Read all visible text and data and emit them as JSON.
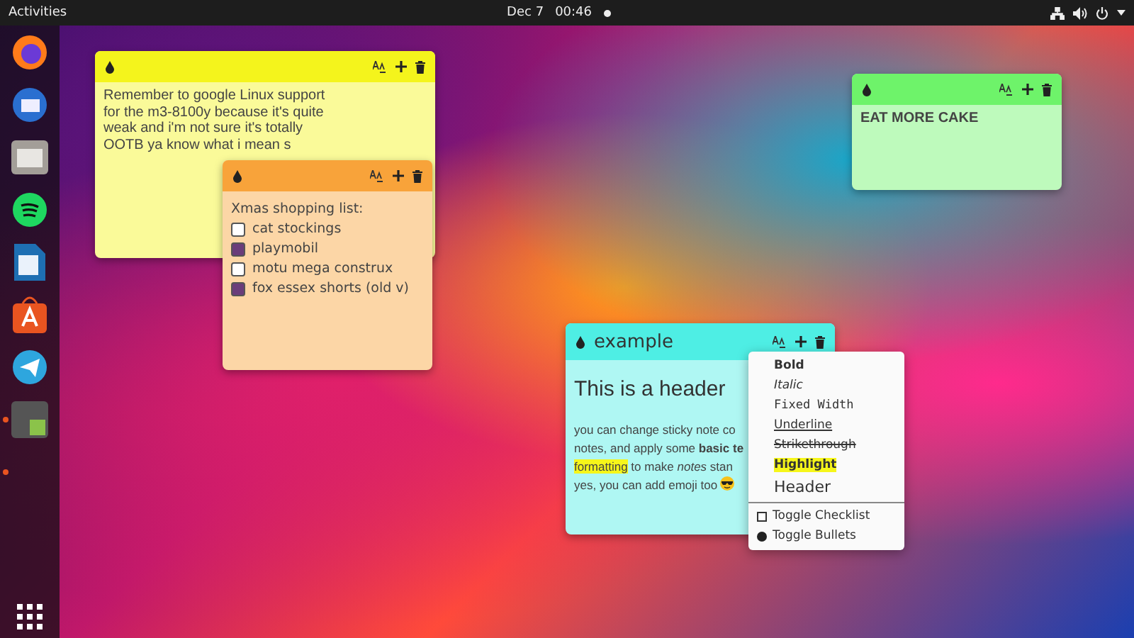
{
  "top_bar": {
    "activities": "Activities",
    "date": "Dec 7",
    "time": "00:46"
  },
  "dock": {
    "apps": [
      {
        "kind": "browser",
        "running": false
      },
      {
        "kind": "mail",
        "running": false
      },
      {
        "kind": "files",
        "running": false
      },
      {
        "kind": "music",
        "running": false
      },
      {
        "kind": "writer",
        "running": false
      },
      {
        "kind": "store",
        "running": false
      },
      {
        "kind": "chat",
        "running": false
      },
      {
        "kind": "puzzle",
        "running": true
      },
      {
        "kind": "empty",
        "running": true
      }
    ]
  },
  "notes": [
    {
      "kind": "text",
      "color": "#f4f41c",
      "bold": false,
      "text": "Remember to google Linux support for the m3-8100y because it's quite weak and i'm not sure it's totally OOTB ya know what i mean s"
    },
    {
      "kind": "checklist",
      "color": "#f8a33a",
      "heading": "Xmas shopping list:",
      "items": [
        {
          "label": "cat stockings",
          "checked": false
        },
        {
          "label": "playmobil",
          "checked": true
        },
        {
          "label": "motu mega construx",
          "checked": false
        },
        {
          "label": "fox essex shorts (old v)",
          "checked": true
        }
      ]
    },
    {
      "kind": "text",
      "color": "#6ef36a",
      "text": "EAT MORE CAKE",
      "bold": true
    },
    {
      "kind": "rich",
      "color": "#4eeee4",
      "title": "example",
      "header": "This is a header",
      "lines": [
        [
          {
            "kind": "plain",
            "text": "you can change sticky note co"
          }
        ],
        [
          {
            "kind": "plain",
            "text": "notes, and apply some "
          },
          {
            "kind": "bold",
            "text": "basic te"
          }
        ],
        [
          {
            "kind": "highlight",
            "text": "formatting"
          },
          {
            "kind": "plain",
            "text": " to make "
          },
          {
            "kind": "italic",
            "text": "notes"
          },
          {
            "kind": "plain",
            "text": " stan"
          }
        ],
        [
          {
            "kind": "plain",
            "text": "yes, you can add emoji too "
          }
        ]
      ]
    }
  ],
  "format_menu": {
    "items": [
      {
        "kind": "bold",
        "label": "Bold"
      },
      {
        "kind": "italic",
        "label": "Italic"
      },
      {
        "kind": "mono",
        "label": "Fixed Width"
      },
      {
        "kind": "underline",
        "label": "Underline"
      },
      {
        "kind": "strike",
        "label": "Strikethrough"
      },
      {
        "kind": "highlight",
        "label": "Highlight"
      },
      {
        "kind": "header",
        "label": "Header"
      },
      {
        "kind": "checklist",
        "label": "Toggle Checklist"
      },
      {
        "kind": "bullets",
        "label": "Toggle Bullets"
      }
    ]
  }
}
